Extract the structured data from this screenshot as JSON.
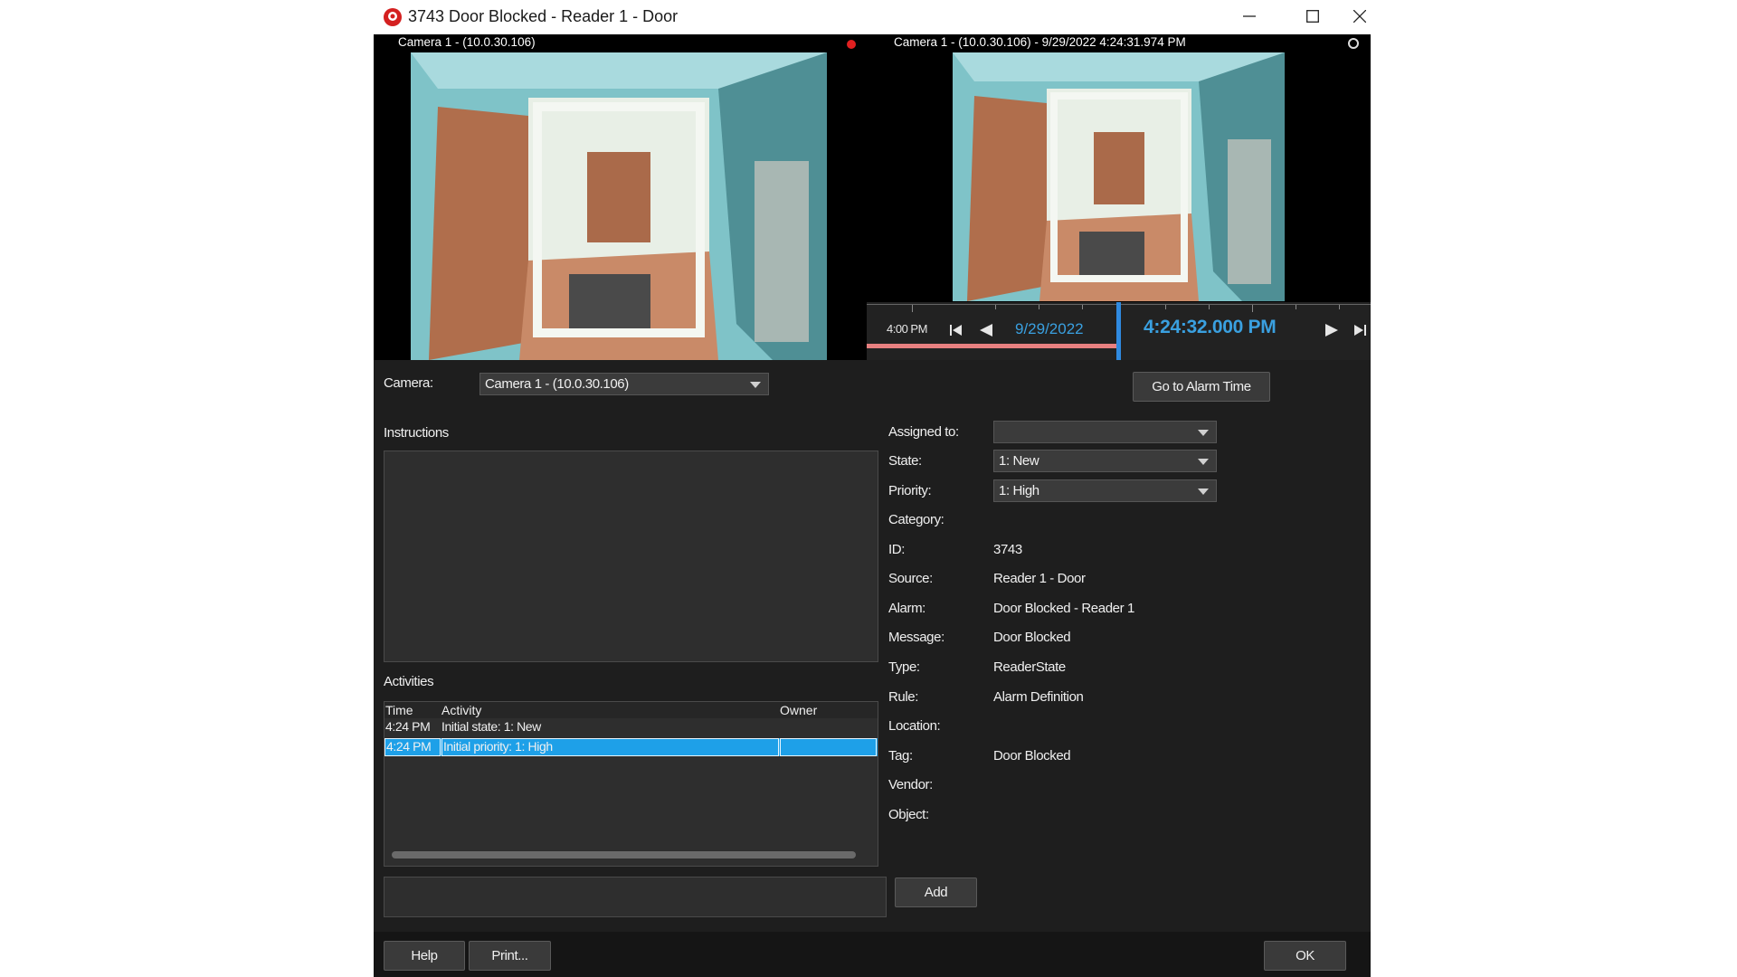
{
  "window": {
    "title": "3743 Door Blocked - Reader 1 - Door",
    "controls": [
      "minimize",
      "maximize",
      "close"
    ]
  },
  "live_camera": {
    "label": "Camera 1 - (10.0.30.106)",
    "indicator": "recording"
  },
  "playback_camera": {
    "label": "Camera 1 - (10.0.30.106) - 9/29/2022 4:24:31.974 PM"
  },
  "timeline": {
    "start_time": "4:00 PM",
    "date": "9/29/2022",
    "current_time": "4:24:32.000 PM"
  },
  "camera_selector": {
    "label": "Camera:",
    "selected": "Camera 1 - (10.0.30.106)"
  },
  "go_to_alarm_button": "Go to Alarm Time",
  "instructions": {
    "label": "Instructions"
  },
  "activities": {
    "label": "Activities",
    "columns": [
      "Time",
      "Activity",
      "Owner"
    ],
    "rows": [
      {
        "time": "4:24 PM",
        "activity": "Initial state: 1: New",
        "owner": ""
      },
      {
        "time": "4:24 PM",
        "activity": "Initial priority: 1: High",
        "owner": ""
      }
    ],
    "add_button": "Add"
  },
  "details": {
    "assigned_to_label": "Assigned to:",
    "assigned_to_value": "",
    "state_label": "State:",
    "state_value": "1: New",
    "priority_label": "Priority:",
    "priority_value": "1: High",
    "category_label": "Category:",
    "id_label": "ID:",
    "id_value": "3743",
    "source_label": "Source:",
    "source_value": "Reader 1 - Door",
    "alarm_label": "Alarm:",
    "alarm_value": "Door Blocked - Reader 1",
    "message_label": "Message:",
    "message_value": "Door Blocked",
    "type_label": "Type:",
    "type_value": "ReaderState",
    "rule_label": "Rule:",
    "rule_value": "Alarm Definition",
    "location_label": "Location:",
    "tag_label": "Tag:",
    "tag_value": "Door Blocked",
    "vendor_label": "Vendor:",
    "object_label": "Object:"
  },
  "footer": {
    "help": "Help",
    "print": "Print...",
    "ok": "OK"
  },
  "colors": {
    "accent": "#1ea0e8",
    "timeline_text": "#3aa0e0",
    "recording": "#e02020",
    "background": "#1e1e1e"
  }
}
